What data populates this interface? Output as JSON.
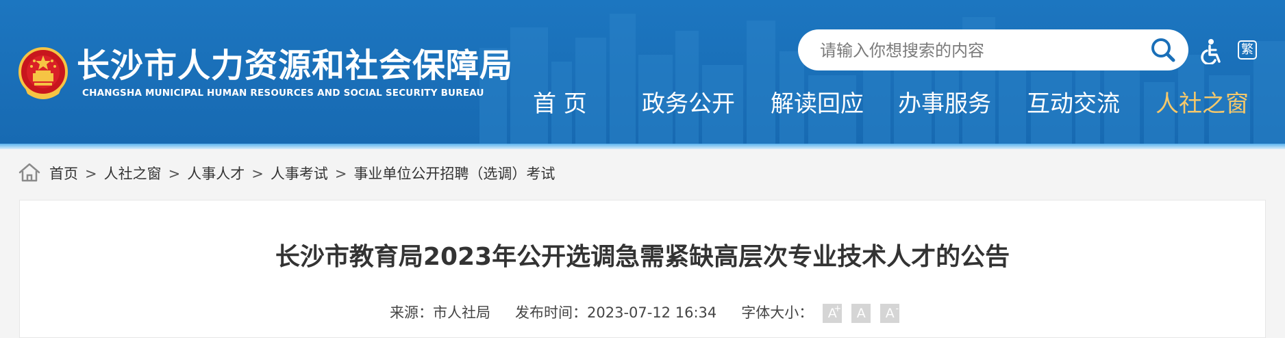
{
  "header": {
    "title": "长沙市人力资源和社会保障局",
    "subtitle": "CHANGSHA MUNICIPAL HUMAN RESOURCES AND SOCIAL SECURITY BUREAU",
    "search": {
      "placeholder": "请输入你想搜索的内容",
      "value": ""
    },
    "traditional_label": "繁",
    "nav": [
      {
        "label": "首 页",
        "active": false
      },
      {
        "label": "政务公开",
        "active": false
      },
      {
        "label": "解读回应",
        "active": false
      },
      {
        "label": "办事服务",
        "active": false
      },
      {
        "label": "互动交流",
        "active": false
      },
      {
        "label": "人社之窗",
        "active": true
      }
    ],
    "colors": {
      "primary": "#1a6fb8",
      "nav_active": "#f5c86b"
    },
    "icons": [
      "national-emblem-icon",
      "search-icon",
      "accessibility-icon",
      "traditional-chinese-icon"
    ]
  },
  "breadcrumb": {
    "items": [
      "首页",
      "人社之窗",
      "人事人才",
      "人事考试",
      "事业单位公开招聘（选调）考试"
    ],
    "separator": ">"
  },
  "article": {
    "title": "长沙市教育局2023年公开选调急需紧缺高层次专业技术人才的公告",
    "source_label": "来源：",
    "source": "市人社局",
    "date_label": "发布时间：",
    "date": "2023-07-12 16:34",
    "font_size_label": "字体大小：",
    "font_buttons": [
      {
        "label": "A",
        "sup": "+"
      },
      {
        "label": "A",
        "sup": ""
      },
      {
        "label": "A",
        "sup": "-"
      }
    ]
  }
}
